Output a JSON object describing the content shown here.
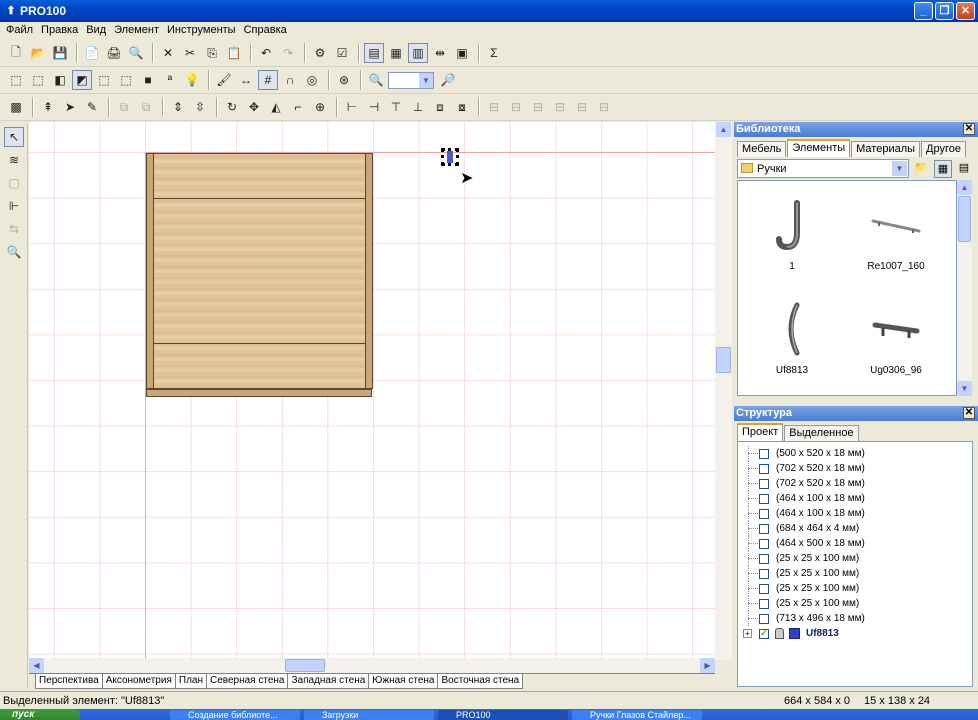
{
  "window": {
    "title": "PRO100",
    "btn_min": "_",
    "btn_max": "❐",
    "btn_close": "✕"
  },
  "menu": [
    "Файл",
    "Правка",
    "Вид",
    "Элемент",
    "Инструменты",
    "Справка"
  ],
  "toolbar1_icons": [
    "new-file-icon",
    "open-folder-icon",
    "save-icon",
    "properties-icon",
    "print-icon",
    "print-preview-icon",
    "delete-icon",
    "cut-icon",
    "copy-icon",
    "paste-icon",
    "undo-icon",
    "redo-icon",
    "settings-icon",
    "check-icon",
    "view-a-icon",
    "view-b-icon",
    "view-c-icon",
    "view-d-icon",
    "view-e-icon",
    "sum-icon"
  ],
  "library": {
    "title": "Библиотека",
    "tabs": [
      "Мебель",
      "Элементы",
      "Материалы",
      "Другое"
    ],
    "active_tab": 1,
    "folder": "Ручки",
    "items": [
      {
        "name": "1",
        "kind": "hook"
      },
      {
        "name": "Re1007_160",
        "kind": "bar"
      },
      {
        "name": "Uf8813",
        "kind": "bow"
      },
      {
        "name": "Ug0306_96",
        "kind": "bar2"
      }
    ]
  },
  "structure": {
    "title": "Структура",
    "tabs": [
      "Проект",
      "Выделенное"
    ],
    "active_tab": 0,
    "rows": [
      "(500 x 520 x 18 мм)",
      "(702 x 520 x 18 мм)",
      "(702 x 520 x 18 мм)",
      "(464 x 100 x 18 мм)",
      "(464 x 100 x 18 мм)",
      "(684 x 464 x 4 мм)",
      "(464 x 500 x 18 мм)",
      "(25 x 25 x 100 мм)",
      "(25 x 25 x 100 мм)",
      "(25 x 25 x 100 мм)",
      "(25 x 25 x 100 мм)",
      "(713 x 496 x 18 мм)"
    ],
    "selected_row": "Uf8813",
    "expand_symbol": "+",
    "checked_symbol": "✓"
  },
  "view_tabs": [
    "Перспектива",
    "Аксонометрия",
    "План",
    "Северная стена",
    "Западная стена",
    "Южная стена",
    "Восточная стена"
  ],
  "status": {
    "selected": "Выделенный элемент: \"Uf8813\"",
    "size1": "664 x 584 x 0",
    "size2": "15 x 138 x 24"
  },
  "taskbar": {
    "start": "пуск",
    "items": [
      "Создание библиоте...",
      "Загрузки",
      "PRO100",
      "Ручки Глазов Стайлер..."
    ]
  }
}
